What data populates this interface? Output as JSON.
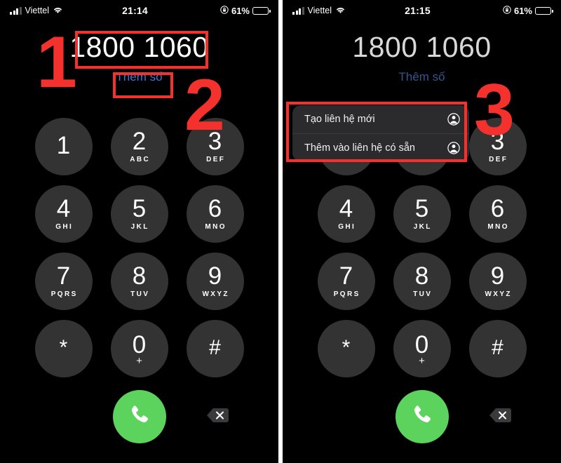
{
  "panels": [
    {
      "id": "left-panel",
      "status_bar": {
        "carrier": "Viettel",
        "time": "21:14",
        "battery_percent": "61%",
        "battery_level": 61,
        "signal_icon": "cellular-signal-icon",
        "wifi_icon": "wifi-icon",
        "lock_icon": "rotation-lock-icon",
        "battery_icon": "battery-icon",
        "battery_color": "#f5cf3a"
      },
      "number_display": {
        "dialed_number": "1800 1060",
        "add_number_label": "Thêm số",
        "add_number_color": "#3c78d8"
      }
    },
    {
      "id": "right-panel",
      "status_bar": {
        "carrier": "Viettel",
        "time": "21:15",
        "battery_percent": "61%",
        "battery_level": 61,
        "signal_icon": "cellular-signal-icon",
        "wifi_icon": "wifi-icon",
        "lock_icon": "rotation-lock-icon",
        "battery_icon": "battery-icon",
        "battery_color": "#f5cf3a"
      },
      "number_display": {
        "dialed_number": "1800 1060",
        "add_number_label": "Thêm số",
        "add_number_color": "#33578f"
      },
      "context_menu": {
        "items": [
          {
            "label": "Tạo liên hệ mới",
            "icon": "contact-person-icon"
          },
          {
            "label": "Thêm vào liên hệ có sẵn",
            "icon": "contact-person-icon"
          }
        ]
      }
    }
  ],
  "keypad": {
    "rows": [
      [
        {
          "digit": "1",
          "letters": ""
        },
        {
          "digit": "2",
          "letters": "ABC"
        },
        {
          "digit": "3",
          "letters": "DEF"
        }
      ],
      [
        {
          "digit": "4",
          "letters": "GHI"
        },
        {
          "digit": "5",
          "letters": "JKL"
        },
        {
          "digit": "6",
          "letters": "MNO"
        }
      ],
      [
        {
          "digit": "7",
          "letters": "PQRS"
        },
        {
          "digit": "8",
          "letters": "TUV"
        },
        {
          "digit": "9",
          "letters": "WXYZ"
        }
      ],
      [
        {
          "digit": "*",
          "letters": ""
        },
        {
          "digit": "0",
          "letters": "+"
        },
        {
          "digit": "#",
          "letters": ""
        }
      ]
    ],
    "key_bg_color": "#333333"
  },
  "actions": {
    "call_button": {
      "icon": "phone-handset-icon",
      "color": "#5cd35c"
    },
    "delete_button": {
      "icon": "backspace-delete-icon",
      "color": "#3a3a3c"
    }
  },
  "annotations": {
    "accent_color": "#f4312c",
    "markers": [
      {
        "id": "1",
        "label": "1"
      },
      {
        "id": "2",
        "label": "2"
      },
      {
        "id": "3",
        "label": "3"
      }
    ],
    "boxes": [
      {
        "id": "number-box",
        "target": "dialed-number"
      },
      {
        "id": "add-number-box",
        "target": "add-number-link"
      },
      {
        "id": "menu-box",
        "target": "context-menu"
      }
    ]
  }
}
